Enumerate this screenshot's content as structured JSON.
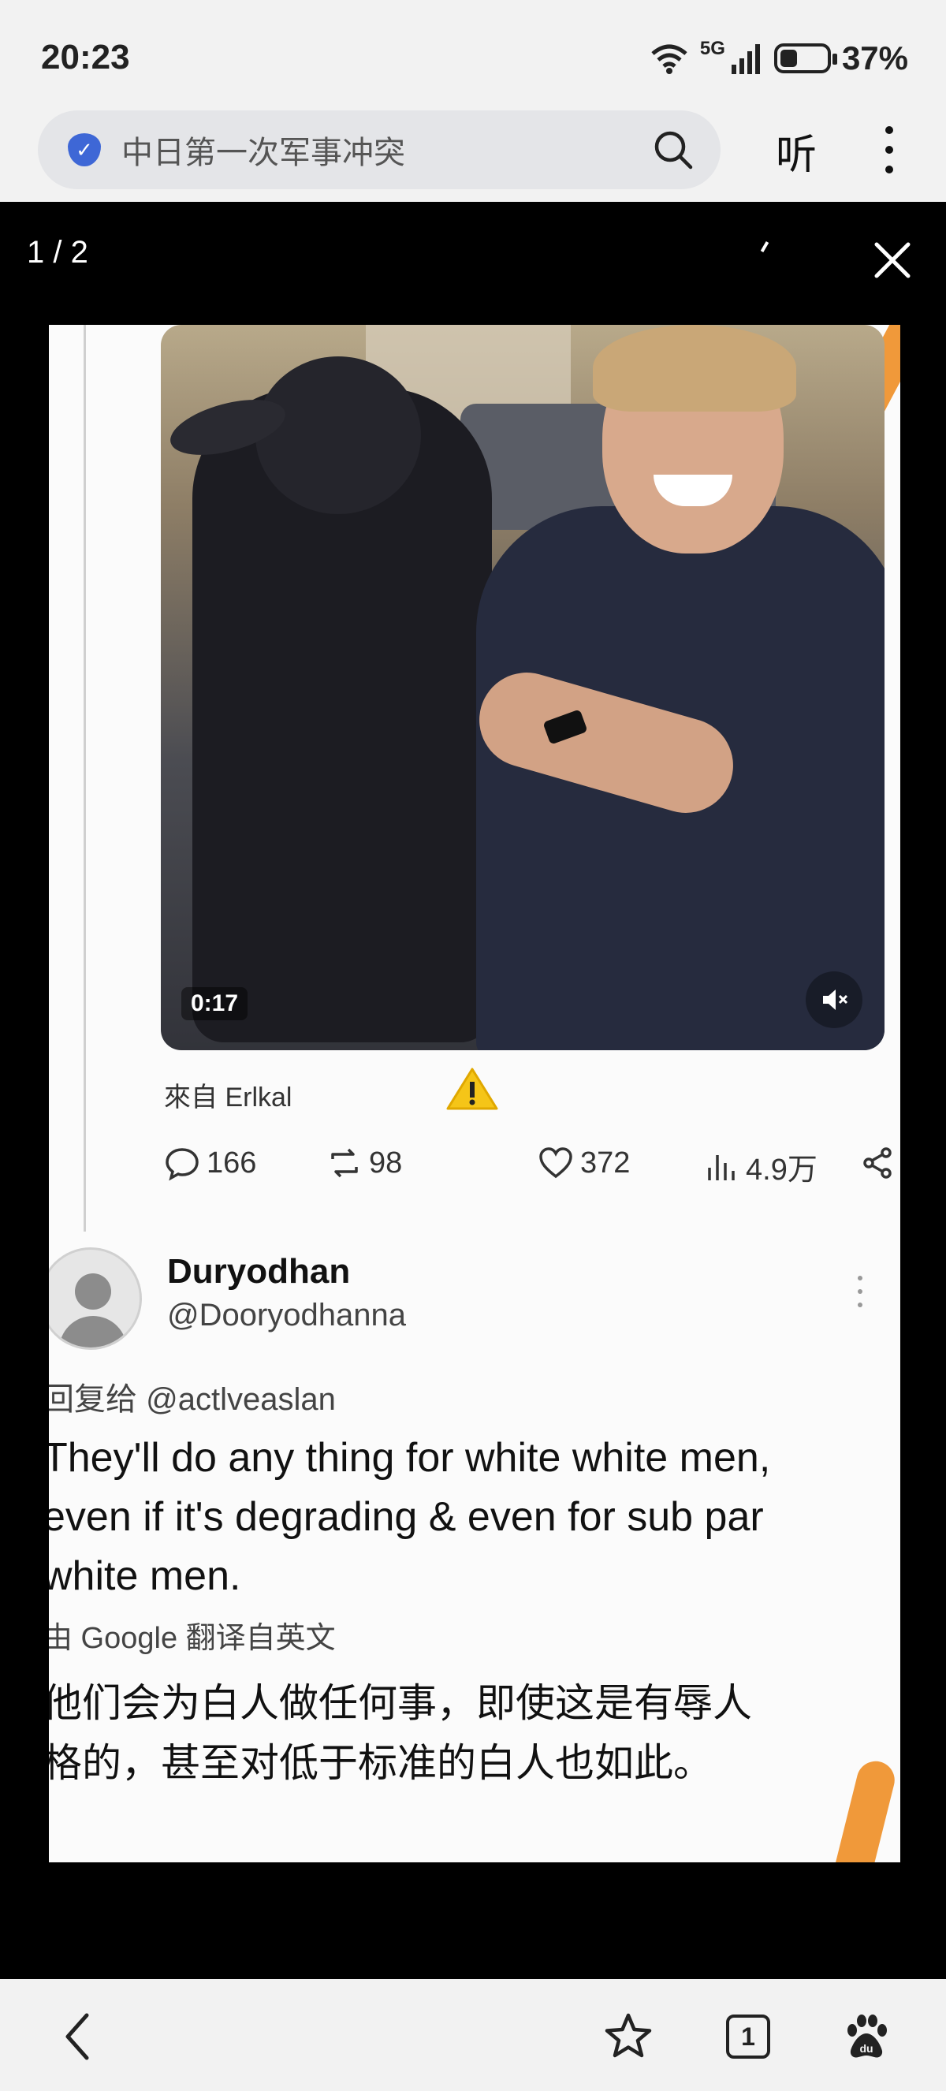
{
  "status_bar": {
    "time": "20:23",
    "network": "5G",
    "battery_percent": "37%",
    "battery_level": 0.37
  },
  "browser": {
    "search_query": "中日第一次军事冲突",
    "listen_label": "听"
  },
  "viewer": {
    "counter": "1 / 2"
  },
  "post": {
    "video_time": "0:17",
    "source": "來自 Erlkal",
    "stats": {
      "replies": "166",
      "reposts": "98",
      "likes": "372",
      "views": "4.9万"
    },
    "reply": {
      "display_name": "Duryodhan",
      "handle": "@Dooryodhanna",
      "reply_to": "回复给 @actlveaslan",
      "text_lines": [
        "They'll do any thing for white white men,",
        "even if it's degrading & even for sub par",
        "white men."
      ],
      "translate_note": "由 Google 翻译自英文",
      "translated_lines": [
        "他们会为白人做任何事，即使这是有辱人",
        "格的，甚至对低于标准的白人也如此。"
      ]
    }
  },
  "bottom_nav": {
    "tab_count": "1"
  },
  "colors": {
    "accent": "#3e67d6",
    "orange": "#f0993a",
    "warning": "#f5c518"
  }
}
